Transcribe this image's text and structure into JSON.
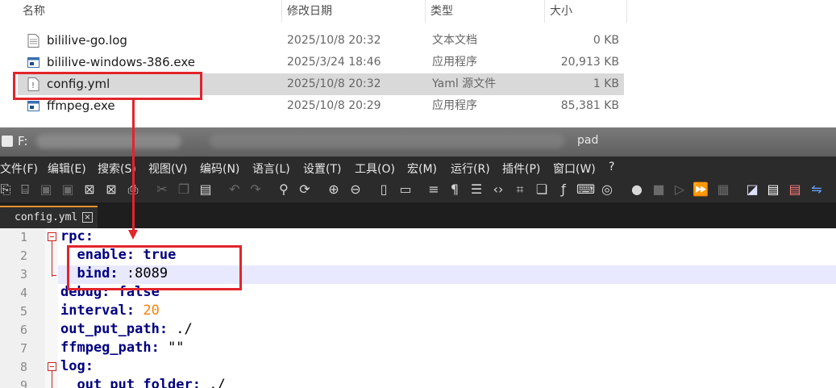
{
  "explorer": {
    "columns": {
      "name": "名称",
      "date": "修改日期",
      "type": "类型",
      "size": "大小"
    },
    "files": [
      {
        "name": "bililive-go.log",
        "date": "2025/10/8 20:32",
        "type": "文本文档",
        "size": "0 KB",
        "icon": "text-file-icon"
      },
      {
        "name": "bililive-windows-386.exe",
        "date": "2025/3/24 18:46",
        "type": "应用程序",
        "size": "20,913 KB",
        "icon": "exe-file-icon"
      },
      {
        "name": "config.yml",
        "date": "2025/10/8 20:32",
        "type": "Yaml 源文件",
        "size": "1 KB",
        "icon": "yaml-file-icon",
        "selected": true
      },
      {
        "name": "ffmpeg.exe",
        "date": "2025/10/8 20:29",
        "type": "应用程序",
        "size": "85,381 KB",
        "icon": "exe-file-icon"
      }
    ]
  },
  "notepad": {
    "title_prefix": "F:",
    "title_suffix": "pad",
    "menu": [
      "文件(F)",
      "编辑(E)",
      "搜索(S)",
      "视图(V)",
      "编码(N)",
      "语言(L)",
      "设置(T)",
      "工具(O)",
      "宏(M)",
      "运行(R)",
      "插件(P)",
      "窗口(W)",
      "?"
    ],
    "tab": {
      "label": "config.yml",
      "close": "×"
    },
    "lines": [
      {
        "n": "1",
        "key": "rpc:",
        "value": ""
      },
      {
        "n": "2",
        "key": "  enable:",
        "value": " true"
      },
      {
        "n": "3",
        "key": "  bind:",
        "value": " :8089"
      },
      {
        "n": "4",
        "key": "debug:",
        "value": " false"
      },
      {
        "n": "5",
        "key": "interval:",
        "value": " 20"
      },
      {
        "n": "6",
        "key": "out_put_path:",
        "value": " ./"
      },
      {
        "n": "7",
        "key": "ffmpeg_path:",
        "value": " \"\""
      },
      {
        "n": "8",
        "key": "log:",
        "value": ""
      },
      {
        "n": "9",
        "key": "  out_put_folder:",
        "value": " ./"
      }
    ]
  },
  "colors": {
    "annotation": "#e3242b",
    "keyword": "#000080",
    "number": "#ff8000",
    "selection": "#d9d9d9"
  }
}
